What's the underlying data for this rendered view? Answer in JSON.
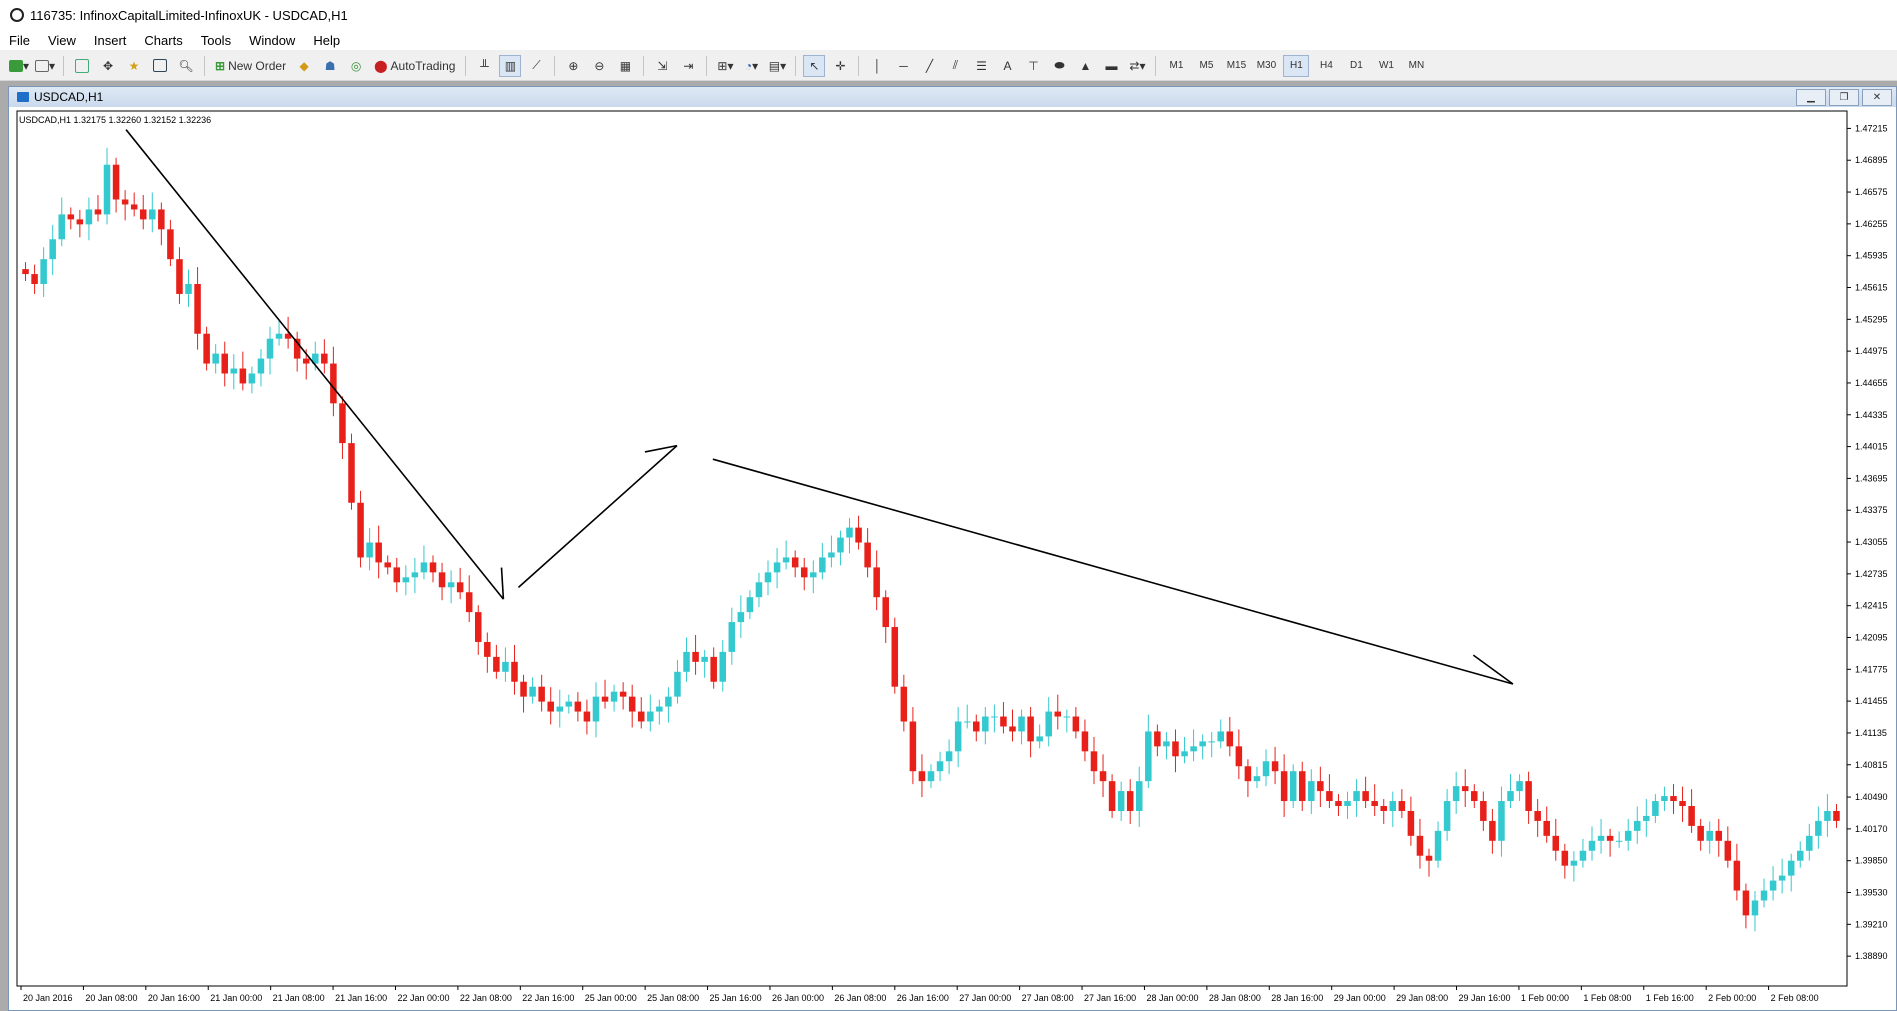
{
  "window": {
    "title": "116735: InfinoxCapitalLimited-InfinoxUK - USDCAD,H1"
  },
  "menu": [
    "File",
    "View",
    "Insert",
    "Charts",
    "Tools",
    "Window",
    "Help"
  ],
  "toolbar": {
    "new_order": "New Order",
    "autotrading": "AutoTrading",
    "timeframes": [
      "M1",
      "M5",
      "M15",
      "M30",
      "H1",
      "H4",
      "D1",
      "W1",
      "MN"
    ],
    "active_timeframe": "H1",
    "icons": [
      "new-chart-icon",
      "profiles-icon",
      "market-watch-icon",
      "navigator-icon",
      "data-window-icon",
      "terminal-icon",
      "strategy-tester-icon",
      "new-order-icon",
      "metaeditor-icon",
      "signals-icon",
      "autotrading-icon",
      "bar-chart-icon",
      "candlestick-icon",
      "line-chart-icon",
      "zoom-in-icon",
      "zoom-out-icon",
      "tile-windows-icon",
      "auto-scroll-icon",
      "chart-shift-icon",
      "indicators-icon",
      "periods-icon",
      "templates-icon",
      "cursor-icon",
      "crosshair-icon",
      "vertical-line-icon",
      "horizontal-line-icon",
      "trendline-icon",
      "equidistant-channel-icon",
      "fibonacci-icon",
      "text-icon",
      "text-label-icon",
      "ellipse-icon",
      "triangle-icon",
      "rectangle-icon",
      "arrows-icon"
    ]
  },
  "chart_window": {
    "title": "USDCAD,H1"
  },
  "chart_data": {
    "type": "candlestick",
    "symbol_info": "USDCAD,H1  1.32175 1.32260 1.32152 1.32236",
    "ylim": [
      1.3863,
      1.4737
    ],
    "y_ticks": [
      "1.47215",
      "1.46895",
      "1.46575",
      "1.46255",
      "1.45935",
      "1.45615",
      "1.45295",
      "1.44975",
      "1.44655",
      "1.44335",
      "1.44015",
      "1.43695",
      "1.43375",
      "1.43055",
      "1.42735",
      "1.42415",
      "1.42095",
      "1.41775",
      "1.41455",
      "1.41135",
      "1.40815",
      "1.40490",
      "1.40170",
      "1.39850",
      "1.39530",
      "1.39210",
      "1.38890"
    ],
    "x_ticks": [
      "20 Jan 2016",
      "20 Jan 08:00",
      "20 Jan 16:00",
      "21 Jan 00:00",
      "21 Jan 08:00",
      "21 Jan 16:00",
      "22 Jan 00:00",
      "22 Jan 08:00",
      "22 Jan 16:00",
      "25 Jan 00:00",
      "25 Jan 08:00",
      "25 Jan 16:00",
      "26 Jan 00:00",
      "26 Jan 08:00",
      "26 Jan 16:00",
      "27 Jan 00:00",
      "27 Jan 08:00",
      "27 Jan 16:00",
      "28 Jan 00:00",
      "28 Jan 08:00",
      "28 Jan 16:00",
      "29 Jan 00:00",
      "29 Jan 08:00",
      "29 Jan 16:00",
      "1 Feb 00:00",
      "1 Feb 08:00",
      "1 Feb 16:00",
      "2 Feb 00:00",
      "2 Feb 08:00"
    ],
    "colors": {
      "bull": "#33c9cf",
      "bear": "#e8201a",
      "grid_text": "#000000",
      "trendline": "#000000"
    },
    "closes": [
      1.4575,
      1.4565,
      1.459,
      1.461,
      1.4635,
      1.463,
      1.4625,
      1.464,
      1.4635,
      1.4685,
      1.465,
      1.4645,
      1.464,
      1.463,
      1.464,
      1.462,
      1.459,
      1.4555,
      1.4565,
      1.4515,
      1.4485,
      1.4495,
      1.4475,
      1.448,
      1.4465,
      1.4475,
      1.449,
      1.451,
      1.4515,
      1.451,
      1.449,
      1.4485,
      1.4495,
      1.4485,
      1.4445,
      1.4405,
      1.4345,
      1.429,
      1.4305,
      1.4285,
      1.428,
      1.4265,
      1.427,
      1.4275,
      1.4285,
      1.4275,
      1.426,
      1.4265,
      1.4255,
      1.4235,
      1.4205,
      1.419,
      1.4175,
      1.4185,
      1.4165,
      1.415,
      1.416,
      1.4145,
      1.4135,
      1.414,
      1.4145,
      1.4135,
      1.4125,
      1.415,
      1.4145,
      1.4155,
      1.415,
      1.4135,
      1.4125,
      1.4135,
      1.414,
      1.415,
      1.4175,
      1.4195,
      1.4185,
      1.419,
      1.4165,
      1.4195,
      1.4225,
      1.4235,
      1.425,
      1.4265,
      1.4275,
      1.4285,
      1.429,
      1.428,
      1.427,
      1.4275,
      1.429,
      1.4295,
      1.431,
      1.432,
      1.4305,
      1.428,
      1.425,
      1.422,
      1.416,
      1.4125,
      1.4075,
      1.4065,
      1.4075,
      1.4085,
      1.4095,
      1.4125,
      1.4125,
      1.4115,
      1.413,
      1.413,
      1.412,
      1.4115,
      1.413,
      1.4105,
      1.411,
      1.4135,
      1.413,
      1.413,
      1.4115,
      1.4095,
      1.4075,
      1.4065,
      1.4035,
      1.4055,
      1.4035,
      1.4065,
      1.4115,
      1.41,
      1.4105,
      1.409,
      1.4095,
      1.41,
      1.4105,
      1.4105,
      1.4115,
      1.41,
      1.408,
      1.4065,
      1.407,
      1.4085,
      1.4075,
      1.4045,
      1.4075,
      1.4045,
      1.4065,
      1.4055,
      1.4045,
      1.404,
      1.4045,
      1.4055,
      1.4045,
      1.404,
      1.4035,
      1.4045,
      1.4035,
      1.401,
      1.399,
      1.3985,
      1.4015,
      1.4045,
      1.406,
      1.4055,
      1.4045,
      1.4025,
      1.4005,
      1.4045,
      1.4055,
      1.4065,
      1.4035,
      1.4025,
      1.401,
      1.3995,
      1.398,
      1.3985,
      1.3995,
      1.4005,
      1.401,
      1.4005,
      1.4005,
      1.4015,
      1.4025,
      1.403,
      1.4045,
      1.405,
      1.4045,
      1.404,
      1.402,
      1.4005,
      1.4015,
      1.4005,
      1.3985,
      1.3955,
      1.393,
      1.3945,
      1.3955,
      1.3965,
      1.397,
      1.3985,
      1.3995,
      1.401,
      1.4025,
      1.4035,
      1.4025
    ]
  }
}
